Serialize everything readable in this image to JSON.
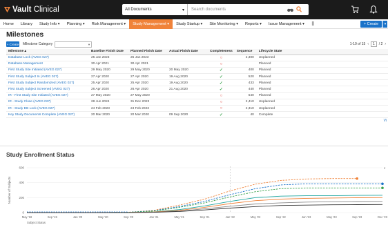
{
  "app": {
    "brand_name": "Vault",
    "brand_suffix": "Clinical"
  },
  "search": {
    "scope": "All Documents",
    "placeholder": "Search documents"
  },
  "nav": {
    "items": [
      "Home",
      "Library",
      "Study Info ▾",
      "Planning ▾",
      "Risk Management ▾",
      "Study Management ▾",
      "Study Startup ▾",
      "Site Monitoring ▾",
      "Reports ▾",
      "Issue Management ▾",
      "⠿"
    ],
    "active_index": 5,
    "create_label": "+ Create"
  },
  "milestones": {
    "title": "Milestones",
    "create_label": "+ Create",
    "category_label": "Milestone Category",
    "category_value": "",
    "pagination": "1-10 of 15",
    "page_current": "1",
    "page_total": "/ 2",
    "columns": [
      "Milestone ▴",
      "Baseline Finish Date",
      "Planned Finish Date",
      "Actual Finish Date",
      "Completeness",
      "Sequence",
      "Lifecycle State"
    ],
    "rows": [
      {
        "milestone": "Database Lock (AVEG 027)",
        "baseline": "25 Jan 2023",
        "planned": "25 Jan 2023",
        "actual": "",
        "complete": false,
        "sequence": "2,300",
        "state": "Unplanned"
      },
      {
        "milestone": "Database Management",
        "baseline": "30 Apr 2021",
        "planned": "30 Apr 2021",
        "actual": "",
        "complete": false,
        "sequence": "",
        "state": "Planned"
      },
      {
        "milestone": "First Study Site Initiated (AVEG 027)",
        "baseline": "29 May 2020",
        "planned": "29 May 2020",
        "actual": "20 May 2020",
        "complete": true,
        "sequence": "400",
        "state": "Planned"
      },
      {
        "milestone": "First Study Subject In (AVEG 027)",
        "baseline": "27 Apr 2020",
        "planned": "27 Apr 2020",
        "actual": "19 Aug 2020",
        "complete": true,
        "sequence": "520",
        "state": "Planned"
      },
      {
        "milestone": "First Study Subject Randomized (AVEG 027)",
        "baseline": "25 Apr 2020",
        "planned": "25 Apr 2020",
        "actual": "19 Aug 2020",
        "complete": true,
        "sequence": "433",
        "state": "Planned"
      },
      {
        "milestone": "First Study Subject Screened (AVEG 027)",
        "baseline": "26 Apr 2020",
        "planned": "26 Apr 2020",
        "actual": "21 Aug 2020",
        "complete": true,
        "sequence": "440",
        "state": "Planned"
      },
      {
        "milestone": "IR - First Study Site Initiated (AVEG 027)",
        "baseline": "27 May 2020",
        "planned": "27 May 2020",
        "actual": "",
        "complete": false,
        "sequence": "540",
        "state": "Planned"
      },
      {
        "milestone": "IR - Study Close (AVEG 027)",
        "baseline": "28 Jun 2024",
        "planned": "31 Dec 2023",
        "actual": "",
        "complete": false,
        "sequence": "2,410",
        "state": "Unplanned"
      },
      {
        "milestone": "IR - Study DB Lock (AVEG 027)",
        "baseline": "24 Feb 2023",
        "planned": "24 Feb 2023",
        "actual": "",
        "complete": false,
        "sequence": "2,310",
        "state": "Unplanned"
      },
      {
        "milestone": "Key Study Documents Complete (AVEG 027)",
        "baseline": "20 Mar 2020",
        "planned": "20 Mar 2020",
        "actual": "09 Sep 2020",
        "complete": true,
        "sequence": "40",
        "state": "Complete"
      }
    ],
    "view_all": "Vi"
  },
  "enrollment": {
    "title": "Study Enrollment Status",
    "right_marker": "J",
    "bottom_label": "Subject Status",
    "colors": {
      "orange": "#f0833a",
      "blue": "#1a73c9",
      "green": "#3aa24c",
      "teal": "#1fa6a0",
      "gray": "#888888",
      "dark": "#333333"
    }
  },
  "chart_data": {
    "type": "line",
    "title": "Study Enrollment Status",
    "ylabel": "Number of Subjects",
    "xlabel": "",
    "y_ticks": [
      "600",
      "400",
      "200",
      "0"
    ],
    "ylim": [
      0,
      600
    ],
    "x_ticks": [
      "May '18",
      "Sep '19",
      "Jan '20",
      "May '20",
      "Sep '20",
      "Jan '21",
      "May '21",
      "Sep '21",
      "Jan '22",
      "May '22",
      "Sep '22",
      "Jan '23",
      "May '23",
      "Sep '23",
      "Dec '23"
    ],
    "series": [
      {
        "color": "#f0833a",
        "dashed": true,
        "marker": true,
        "values": [
          0,
          0,
          0,
          0,
          5,
          30,
          100,
          180,
          290,
          380,
          430,
          450,
          455,
          455,
          null
        ]
      },
      {
        "color": "#1a73c9",
        "dashed": true,
        "marker": true,
        "values": [
          0,
          0,
          0,
          0,
          5,
          25,
          80,
          150,
          240,
          320,
          370,
          385,
          385,
          385,
          385
        ]
      },
      {
        "color": "#3aa24c",
        "dashed": true,
        "marker": true,
        "values": [
          0,
          0,
          0,
          0,
          4,
          20,
          70,
          130,
          210,
          280,
          320,
          330,
          330,
          330,
          330
        ]
      },
      {
        "color": "#1fa6a0",
        "dashed": false,
        "marker": false,
        "values": [
          0,
          0,
          0,
          0,
          2,
          10,
          40,
          90,
          150,
          200,
          220,
          225,
          225,
          230,
          232
        ]
      },
      {
        "color": "#f0833a",
        "dashed": false,
        "marker": false,
        "values": [
          0,
          0,
          0,
          0,
          2,
          8,
          30,
          70,
          120,
          160,
          180,
          190,
          195,
          198,
          200
        ]
      },
      {
        "color": "#888888",
        "dashed": false,
        "marker": false,
        "values": [
          0,
          0,
          0,
          0,
          1,
          5,
          20,
          50,
          85,
          115,
          130,
          140,
          145,
          148,
          150
        ]
      },
      {
        "color": "#333333",
        "dashed": false,
        "marker": false,
        "values": [
          0,
          0,
          0,
          0,
          1,
          4,
          15,
          35,
          60,
          80,
          95,
          100,
          104,
          106,
          108
        ]
      }
    ]
  }
}
